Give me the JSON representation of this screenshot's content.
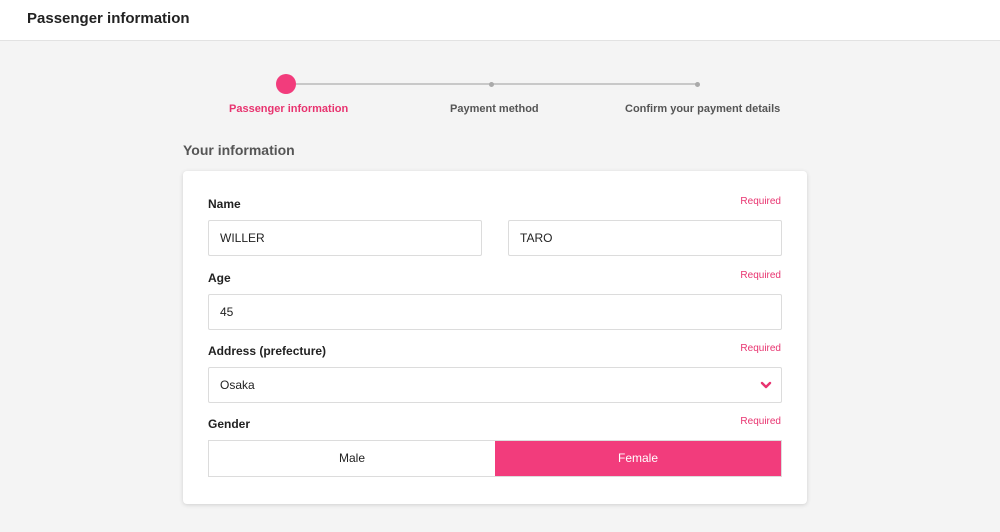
{
  "header": {
    "title": "Passenger information"
  },
  "stepper": {
    "steps": [
      {
        "label": "Passenger information",
        "active": true
      },
      {
        "label": "Payment method",
        "active": false
      },
      {
        "label": "Confirm your payment details",
        "active": false
      }
    ]
  },
  "section": {
    "title": "Your information"
  },
  "form": {
    "required_label": "Required",
    "name": {
      "label": "Name",
      "last_name": "WILLER",
      "first_name": "TARO"
    },
    "age": {
      "label": "Age",
      "value": "45"
    },
    "address": {
      "label": "Address (prefecture)",
      "value": "Osaka"
    },
    "gender": {
      "label": "Gender",
      "male": "Male",
      "female": "Female",
      "selected": "Female"
    }
  },
  "colors": {
    "accent": "#f23c7c",
    "accent_text": "#e8336f"
  },
  "icons": {
    "select": "chevron-down-icon"
  }
}
